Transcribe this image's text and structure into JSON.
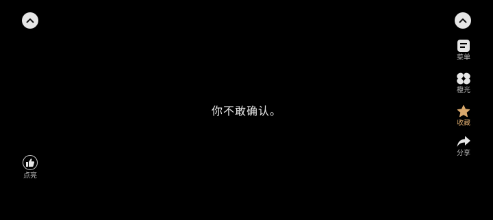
{
  "main": {
    "text": "你不敢确认。"
  },
  "right_toolbar": {
    "menu_label": "菜单",
    "light_label": "橙光",
    "favorite_label": "收藏",
    "share_label": "分享"
  },
  "left_toolbar": {
    "like_label": "点亮"
  },
  "icons": {
    "collapse_left": "chevron-up-icon",
    "collapse_right": "chevron-up-icon",
    "menu": "menu-icon",
    "light": "orange-light-icon",
    "favorite": "star-icon",
    "share": "share-arrow-icon",
    "like": "thumbs-up-icon"
  },
  "colors": {
    "background": "#000000",
    "text": "#e8e8e8",
    "label": "#bdbdbd",
    "favorite_accent": "#d9a86c",
    "button_fill": "#e6e6e6"
  }
}
